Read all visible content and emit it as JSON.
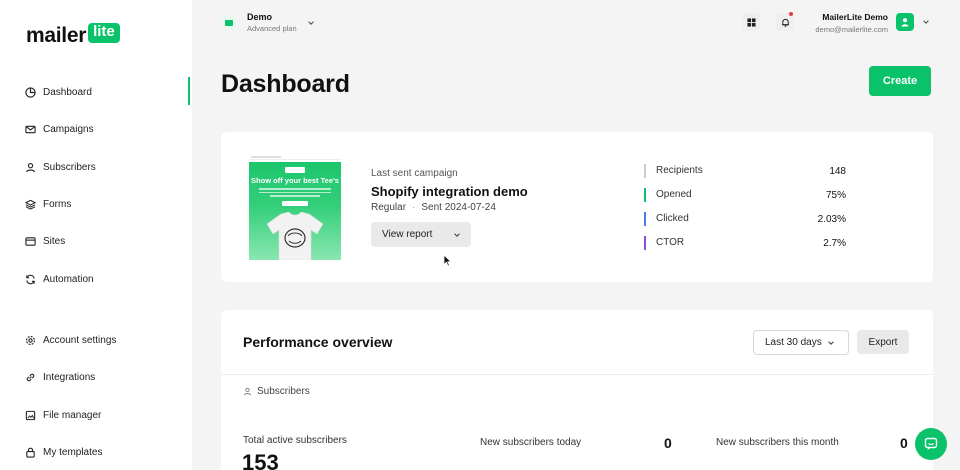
{
  "brand": {
    "logo_main": "mailer",
    "logo_badge": "lite",
    "accent": "#09c269"
  },
  "account": {
    "name": "Demo",
    "plan": "Advanced plan"
  },
  "user": {
    "name": "MailerLite Demo",
    "email": "demo@mailerlite.com"
  },
  "sidebar": {
    "items": [
      {
        "label": "Dashboard",
        "icon": "dashboard-icon",
        "active": true
      },
      {
        "label": "Campaigns",
        "icon": "mail-icon"
      },
      {
        "label": "Subscribers",
        "icon": "user-icon"
      },
      {
        "label": "Forms",
        "icon": "layers-icon"
      },
      {
        "label": "Sites",
        "icon": "browser-icon"
      },
      {
        "label": "Automation",
        "icon": "refresh-icon"
      },
      {
        "label": "Account settings",
        "icon": "gear-icon"
      },
      {
        "label": "Integrations",
        "icon": "link-icon"
      },
      {
        "label": "File manager",
        "icon": "file-icon"
      },
      {
        "label": "My templates",
        "icon": "lock-icon"
      }
    ]
  },
  "page": {
    "title": "Dashboard",
    "create_label": "Create"
  },
  "campaign": {
    "kicker": "Last sent campaign",
    "name": "Shopify integration demo",
    "type": "Regular",
    "sent": "Sent 2024-07-24",
    "view_report_label": "View report",
    "thumbnail_title": "Show off your best Tee's",
    "stats": [
      {
        "label": "Recipients",
        "value": "148",
        "color": "#cccccc"
      },
      {
        "label": "Opened",
        "value": "75%",
        "color": "#09c269"
      },
      {
        "label": "Clicked",
        "value": "2.03%",
        "color": "#4a7bf0"
      },
      {
        "label": "CTOR",
        "value": "2.7%",
        "color": "#8a4fe0"
      }
    ]
  },
  "performance": {
    "title": "Performance overview",
    "range_value": "Last 30 days",
    "export_label": "Export",
    "section_label": "Subscribers",
    "total_active_label": "Total active subscribers",
    "total_active_value": "153",
    "new_today_label": "New subscribers today",
    "new_today_value": "0",
    "new_month_label": "New subscribers this month",
    "new_month_value": "0"
  }
}
